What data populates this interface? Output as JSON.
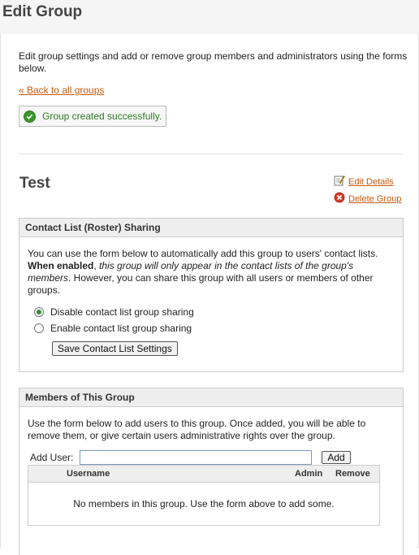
{
  "page": {
    "title": "Edit Group"
  },
  "intro": "Edit group settings and add or remove group members and administrators using the forms below.",
  "back_link": "« Back to all groups",
  "success": {
    "message": "Group created successfully."
  },
  "group": {
    "name": "Test",
    "edit_label": "Edit Details",
    "delete_label": "Delete Group"
  },
  "sharing": {
    "title": "Contact List (Roster) Sharing",
    "desc_1": "You can use the form below to automatically add this group to users' contact lists. ",
    "desc_bold": "When enabled",
    "desc_comma": ", ",
    "desc_italic": "this group will only appear in the contact lists of the group's members",
    "desc_2": ". However, you can share this group with all users or members of other groups.",
    "options": [
      {
        "label": "Disable contact list group sharing",
        "selected": true
      },
      {
        "label": "Enable contact list group sharing",
        "selected": false
      }
    ],
    "save_label": "Save Contact List Settings"
  },
  "members": {
    "title": "Members of This Group",
    "desc": "Use the form below to add users to this group. Once added, you will be able to remove them, or give certain users administrative rights over the group.",
    "add_user_label": "Add User:",
    "add_user_value": "",
    "add_button": "Add",
    "columns": {
      "username": "Username",
      "admin": "Admin",
      "remove": "Remove"
    },
    "empty_message": "No members in this group. Use the form above to add some."
  },
  "colors": {
    "link": "#c8590b",
    "success": "#2c7a22",
    "radio_selected": "#2f8d2a"
  }
}
